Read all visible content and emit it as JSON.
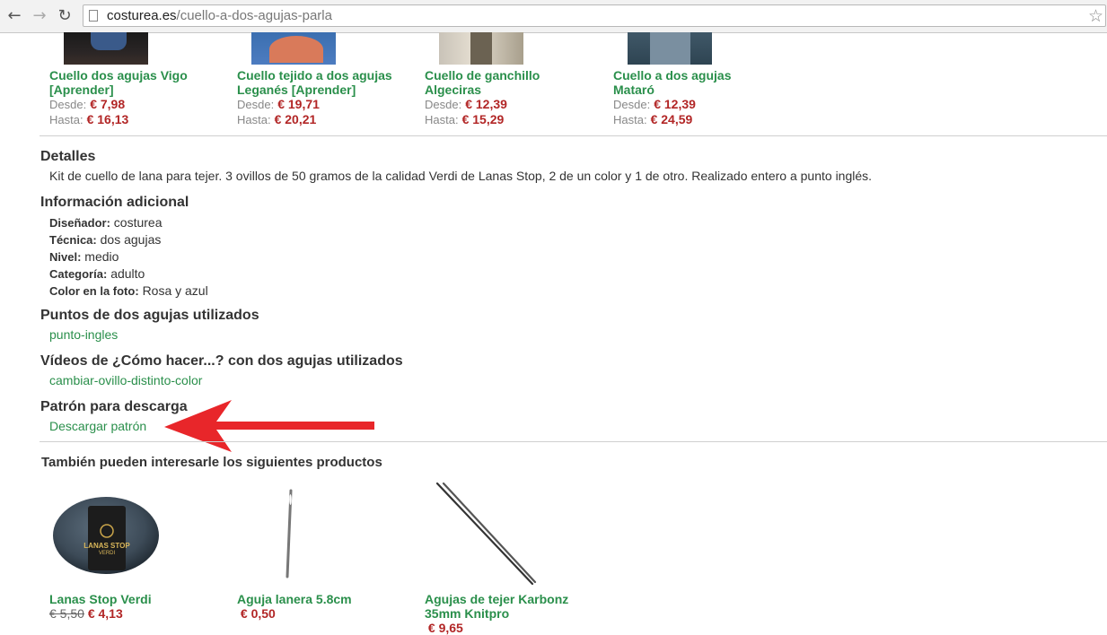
{
  "browser": {
    "url_domain": "costurea.es",
    "url_path": "/cuello-a-dos-agujas-parla"
  },
  "top_products": [
    {
      "name_line1": "Cuello dos agujas Vigo",
      "name_line2": "[Aprender]",
      "desde_label": "Desde:",
      "desde": "€ 7,98",
      "hasta_label": "Hasta:",
      "hasta": "€ 16,13"
    },
    {
      "name_line1": "Cuello tejido a dos agujas",
      "name_line2": "Leganés [Aprender]",
      "desde_label": "Desde:",
      "desde": "€ 19,71",
      "hasta_label": "Hasta:",
      "hasta": "€ 20,21"
    },
    {
      "name_line1": "Cuello de ganchillo",
      "name_line2": "Algeciras",
      "desde_label": "Desde:",
      "desde": "€ 12,39",
      "hasta_label": "Hasta:",
      "hasta": "€ 15,29"
    },
    {
      "name_line1": "Cuello a dos agujas",
      "name_line2": "Mataró",
      "desde_label": "Desde:",
      "desde": "€ 12,39",
      "hasta_label": "Hasta:",
      "hasta": "€ 24,59"
    }
  ],
  "details": {
    "heading": "Detalles",
    "text": "Kit de cuello de lana para tejer. 3 ovillos de 50 gramos de la calidad Verdi de Lanas Stop, 2 de un color y 1 de otro. Realizado entero a punto inglés."
  },
  "additional": {
    "heading": "Información adicional",
    "rows": [
      {
        "label": "Diseñador:",
        "value": "costurea"
      },
      {
        "label": "Técnica:",
        "value": "dos agujas"
      },
      {
        "label": "Nivel:",
        "value": "medio"
      },
      {
        "label": "Categoría:",
        "value": "adulto"
      },
      {
        "label": "Color en la foto:",
        "value": "Rosa y azul"
      }
    ]
  },
  "stitches": {
    "heading": "Puntos de dos agujas utilizados",
    "link": "punto-ingles"
  },
  "videos": {
    "heading": "Vídeos de ¿Cómo hacer...? con dos agujas utilizados",
    "link": "cambiar-ovillo-distinto-color"
  },
  "pattern": {
    "heading": "Patrón para descarga",
    "link": "Descargar patrón"
  },
  "related": {
    "heading": "También pueden interesarle los siguientes productos",
    "items": [
      {
        "name_line1": "Lanas Stop Verdi",
        "name_line2": "",
        "old_price": "€ 5,50",
        "price": "€ 4,13",
        "label_brand": "LANAS STOP",
        "label_sub": "VERDI"
      },
      {
        "name_line1": "Aguja lanera 5.8cm",
        "name_line2": "",
        "old_price": "",
        "price": "€ 0,50"
      },
      {
        "name_line1": "Agujas de tejer Karbonz",
        "name_line2": "35mm Knitpro",
        "old_price": "",
        "price": "€ 9,65"
      }
    ]
  },
  "colors": {
    "link": "#2a8f4b",
    "price": "#b22626",
    "annotation_arrow": "#e8262a"
  }
}
